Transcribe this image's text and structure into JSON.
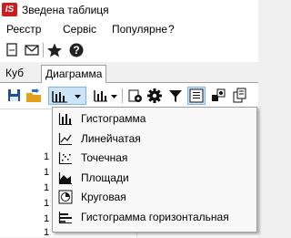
{
  "window": {
    "title": "Зведена таблиця",
    "logo_text": "IS"
  },
  "menubar": {
    "items": [
      "Реєстр",
      "Сервіс",
      "Популярне",
      "?"
    ]
  },
  "tabs": [
    {
      "label": "Куб",
      "active": false
    },
    {
      "label": "Диаграмма",
      "active": true
    }
  ],
  "row_labels": [
    "1",
    "1",
    "1",
    "1",
    "1",
    "1"
  ],
  "chart_menu": {
    "items": [
      {
        "label": "Гистограмма",
        "icon": "histogram-icon"
      },
      {
        "label": "Линейчатая",
        "icon": "line-chart-icon"
      },
      {
        "label": "Точечная",
        "icon": "scatter-icon"
      },
      {
        "label": "Площади",
        "icon": "area-chart-icon"
      },
      {
        "label": "Круговая",
        "icon": "pie-chart-icon"
      },
      {
        "label": "Гистограмма горизонтальная",
        "icon": "horizontal-histogram-icon"
      }
    ]
  },
  "colors": {
    "accent": "#0078d7",
    "logo": "#c81e1e",
    "pressed_bg": "#cce4f7"
  }
}
